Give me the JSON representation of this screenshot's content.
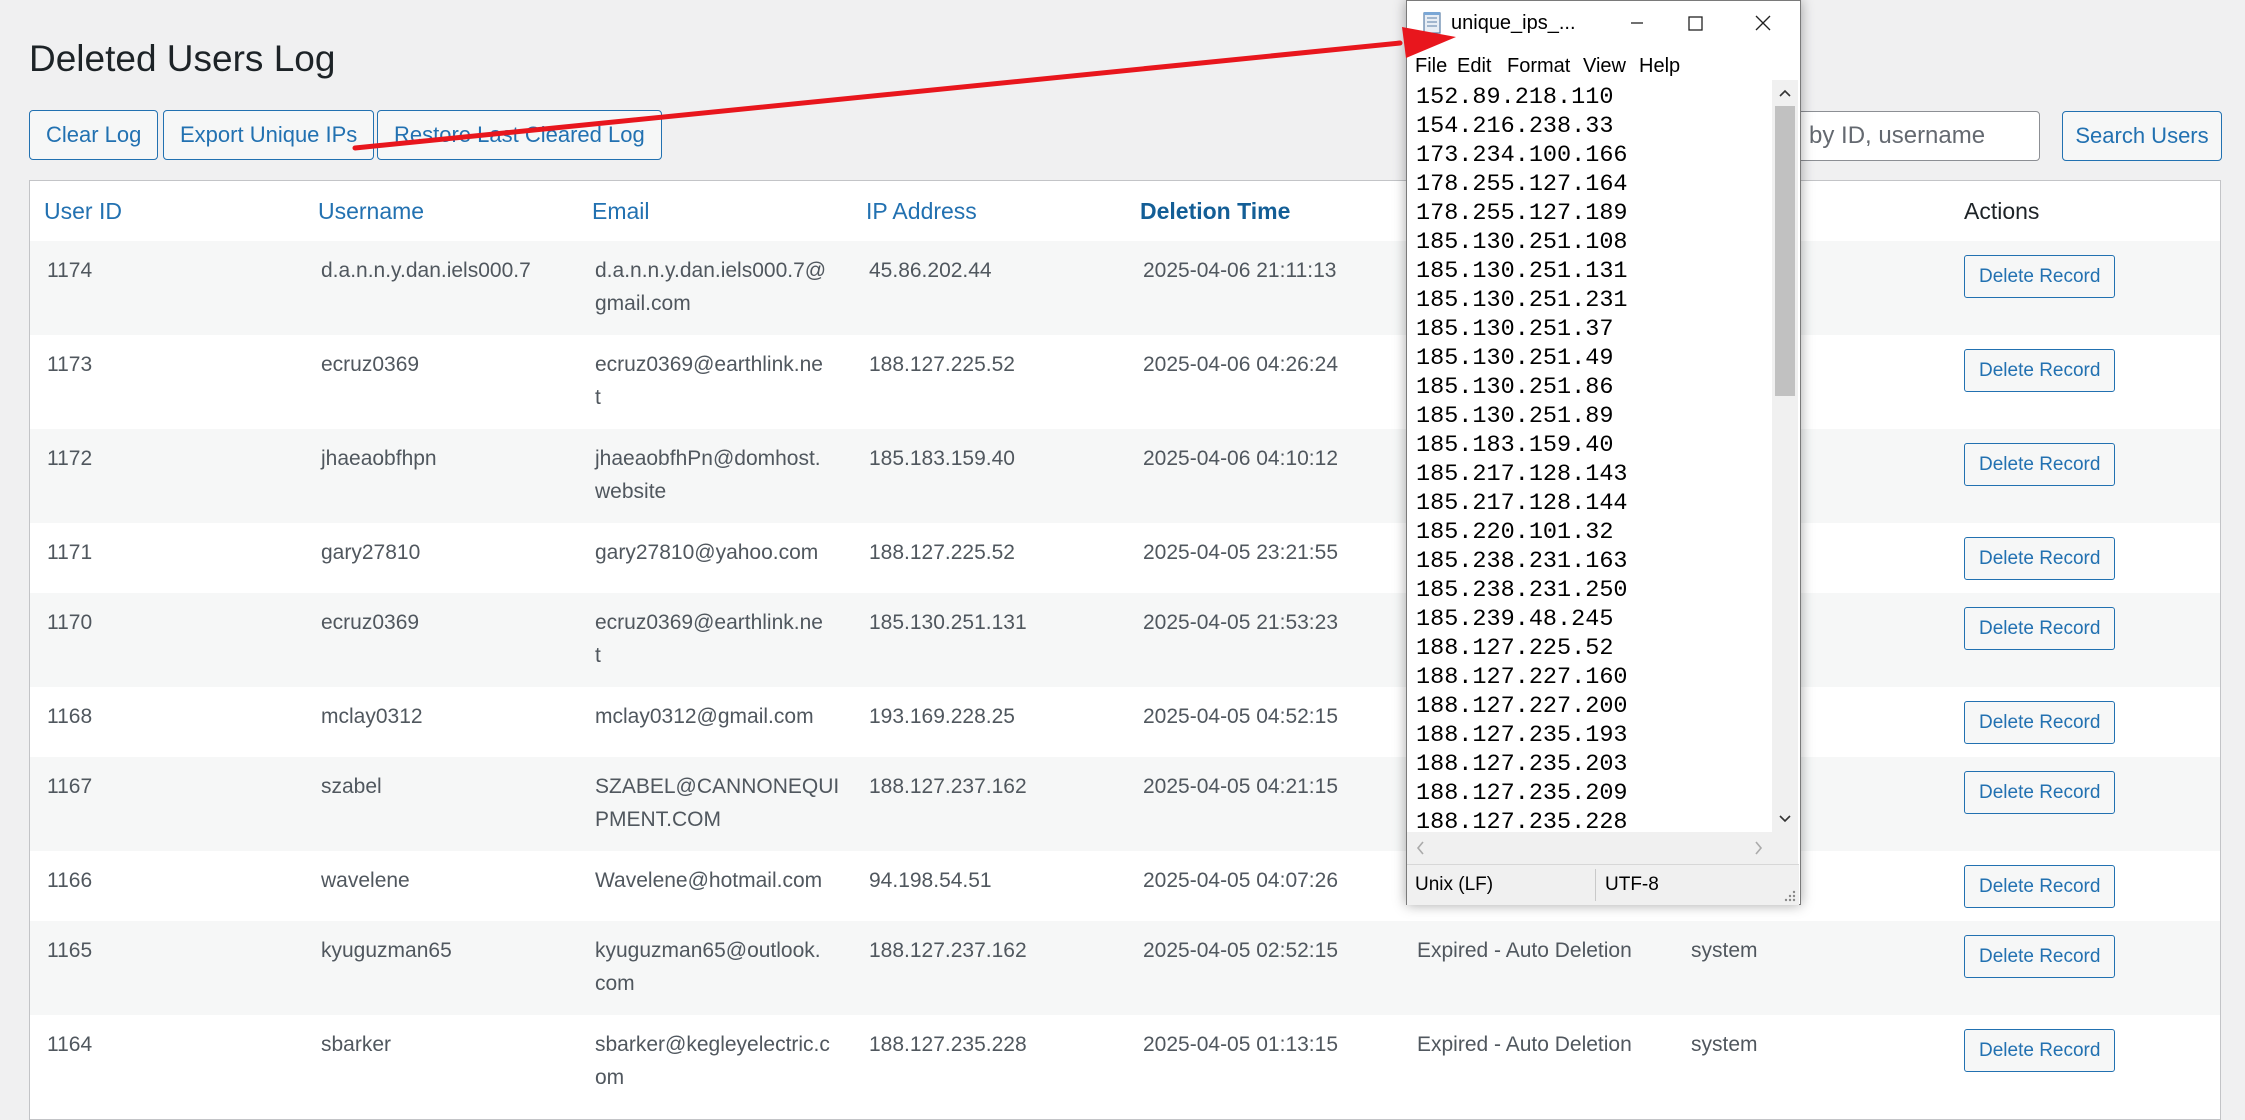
{
  "page": {
    "title": "Deleted Users Log"
  },
  "toolbar": {
    "clear_label": "Clear Log",
    "export_label": "Export Unique IPs",
    "restore_label": "Restore Last Cleared Log",
    "search_placeholder": "Search by ID, username",
    "search_visible_text": "ch by ID, username",
    "search_button_label": "Search Users"
  },
  "table": {
    "columns": [
      "User ID",
      "Username",
      "Email",
      "IP Address",
      "Deletion Time",
      "",
      "",
      "Actions"
    ],
    "sorted_column": "Deletion Time",
    "action_label": "Delete Record",
    "rows": [
      {
        "id": "1174",
        "username": "d.a.n.n.y.dan.iels000.7",
        "email": "d.a.n.n.y.dan.iels000.7@\ngmail.com",
        "ip": "45.86.202.44",
        "time": "2025-04-06 21:11:13",
        "reason": "",
        "by": ""
      },
      {
        "id": "1173",
        "username": "ecruz0369",
        "email": "ecruz0369@earthlink.ne\nt",
        "ip": "188.127.225.52",
        "time": "2025-04-06 04:26:24",
        "reason": "",
        "by": ""
      },
      {
        "id": "1172",
        "username": "jhaeaobfhpn",
        "email": "jhaeaobfhPn@domhost.\nwebsite",
        "ip": "185.183.159.40",
        "time": "2025-04-06 04:10:12",
        "reason": "",
        "by": ""
      },
      {
        "id": "1171",
        "username": "gary27810",
        "email": "gary27810@yahoo.com",
        "ip": "188.127.225.52",
        "time": "2025-04-05 23:21:55",
        "reason": "",
        "by": ""
      },
      {
        "id": "1170",
        "username": "ecruz0369",
        "email": "ecruz0369@earthlink.ne\nt",
        "ip": "185.130.251.131",
        "time": "2025-04-05 21:53:23",
        "reason": "",
        "by": ""
      },
      {
        "id": "1168",
        "username": "mclay0312",
        "email": "mclay0312@gmail.com",
        "ip": "193.169.228.25",
        "time": "2025-04-05 04:52:15",
        "reason": "",
        "by": ""
      },
      {
        "id": "1167",
        "username": "szabel",
        "email": "SZABEL@CANNONEQUI\nPMENT.COM",
        "ip": "188.127.237.162",
        "time": "2025-04-05 04:21:15",
        "reason": "",
        "by": ""
      },
      {
        "id": "1166",
        "username": "wavelene",
        "email": "Wavelene@hotmail.com",
        "ip": "94.198.54.51",
        "time": "2025-04-05 04:07:26",
        "reason": "",
        "by": ""
      },
      {
        "id": "1165",
        "username": "kyuguzman65",
        "email": "kyuguzman65@outlook.\ncom",
        "ip": "188.127.237.162",
        "time": "2025-04-05 02:52:15",
        "reason": "Expired - Auto Deletion",
        "by": "system"
      },
      {
        "id": "1164",
        "username": "sbarker",
        "email": "sbarker@kegleyelectric.c\nom",
        "ip": "188.127.235.228",
        "time": "2025-04-05 01:13:15",
        "reason": "Expired - Auto Deletion",
        "by": "system"
      }
    ]
  },
  "notepad": {
    "title": "unique_ips_...",
    "menu": [
      "File",
      "Edit",
      "Format",
      "View",
      "Help"
    ],
    "lines": [
      "152.89.218.110",
      "154.216.238.33",
      "173.234.100.166",
      "178.255.127.164",
      "178.255.127.189",
      "185.130.251.108",
      "185.130.251.131",
      "185.130.251.231",
      "185.130.251.37",
      "185.130.251.49",
      "185.130.251.86",
      "185.130.251.89",
      "185.183.159.40",
      "185.217.128.143",
      "185.217.128.144",
      "185.220.101.32",
      "185.238.231.163",
      "185.238.231.250",
      "185.239.48.245",
      "188.127.225.52",
      "188.127.227.160",
      "188.127.227.200",
      "188.127.235.193",
      "188.127.235.203",
      "188.127.235.209",
      "188.127.235.228"
    ],
    "status_eol": "Unix (LF)",
    "status_encoding": "UTF-8"
  },
  "annotation": {
    "color": "#e8161d"
  }
}
